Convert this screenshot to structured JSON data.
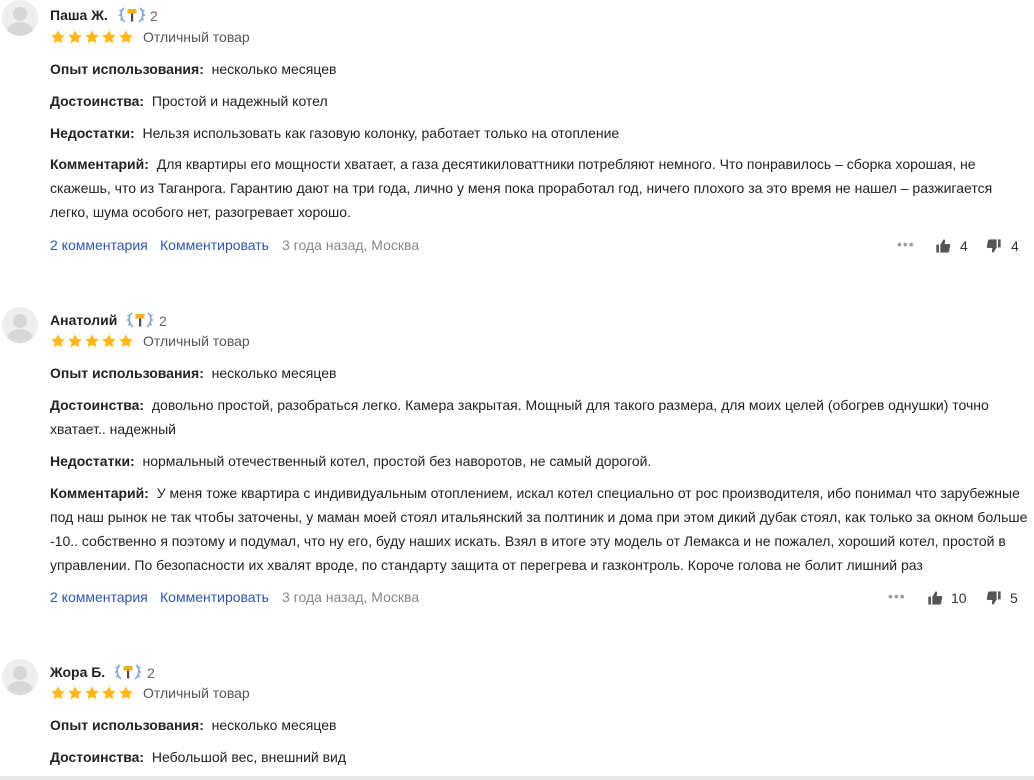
{
  "grade_label": "Отличный товар",
  "labels": {
    "experience": "Опыт использования:",
    "pros": "Достоинства:",
    "cons": "Недостатки:",
    "comment": "Комментарий:"
  },
  "comment_action": "Комментировать",
  "reviews": [
    {
      "author": "Паша Ж.",
      "badge_count": "2",
      "rating": 5,
      "experience": "несколько месяцев",
      "pros": "Простой и надежный котел",
      "cons": "Нельзя использовать как газовую колонку, работает только на отопление",
      "comment_lines": [
        "Для квартиры его мощности хватает, а газа десятикиловаттники потребляют немного. Что понравилось – сборка хорошая, не",
        "скажешь, что из Таганрога. Гарантию дают на три года, лично у меня пока проработал год, ничего плохого за это время не нашел – разжигается",
        "легко, шума особого нет, разогревает хорошо."
      ],
      "comments_link": "2 комментария",
      "meta": "3 года назад, Москва",
      "likes": "4",
      "dislikes": "4"
    },
    {
      "author": "Анатолий",
      "badge_count": "2",
      "rating": 5,
      "experience": "несколько месяцев",
      "pros_lines": [
        "довольно простой, разобраться легко. Камера закрытая. Мощный для такого размера, для моих целей (обогрев однушки) точно",
        "хватает.. надежный"
      ],
      "cons": "нормальный отечественный котел, простой без наворотов, не самый дорогой.",
      "comment_lines": [
        "У меня тоже квартира с индивидуальным отоплением, искал котел специально от рос производителя, ибо понимал что зарубежные",
        "под наш рынок не так чтобы заточены, у маман моей стоял итальянский за полтиник и дома при этом дикий дубак стоял, как только за окном больше",
        "-10.. собственно я поэтому и подумал, что ну его, буду наших искать. Взял в итоге эту модель от Лемакса и не пожалел, хороший котел, простой в",
        "управлении. По безопасности их хвалят вроде, по стандарту защита от перегрева и газконтроль. Короче голова не болит лишний раз"
      ],
      "comments_link": "2 комментария",
      "meta": "3 года назад, Москва",
      "likes": "10",
      "dislikes": "5"
    },
    {
      "author": "Жора Б.",
      "badge_count": "2",
      "rating": 5,
      "experience": "несколько месяцев",
      "pros": "Небольшой вес, внешний вид"
    }
  ],
  "colors": {
    "star": "#fdb81e",
    "link": "#2f55b3",
    "meta": "#888888",
    "badge_blue": "#79a6d8",
    "badge_gold": "#f2b01e"
  }
}
